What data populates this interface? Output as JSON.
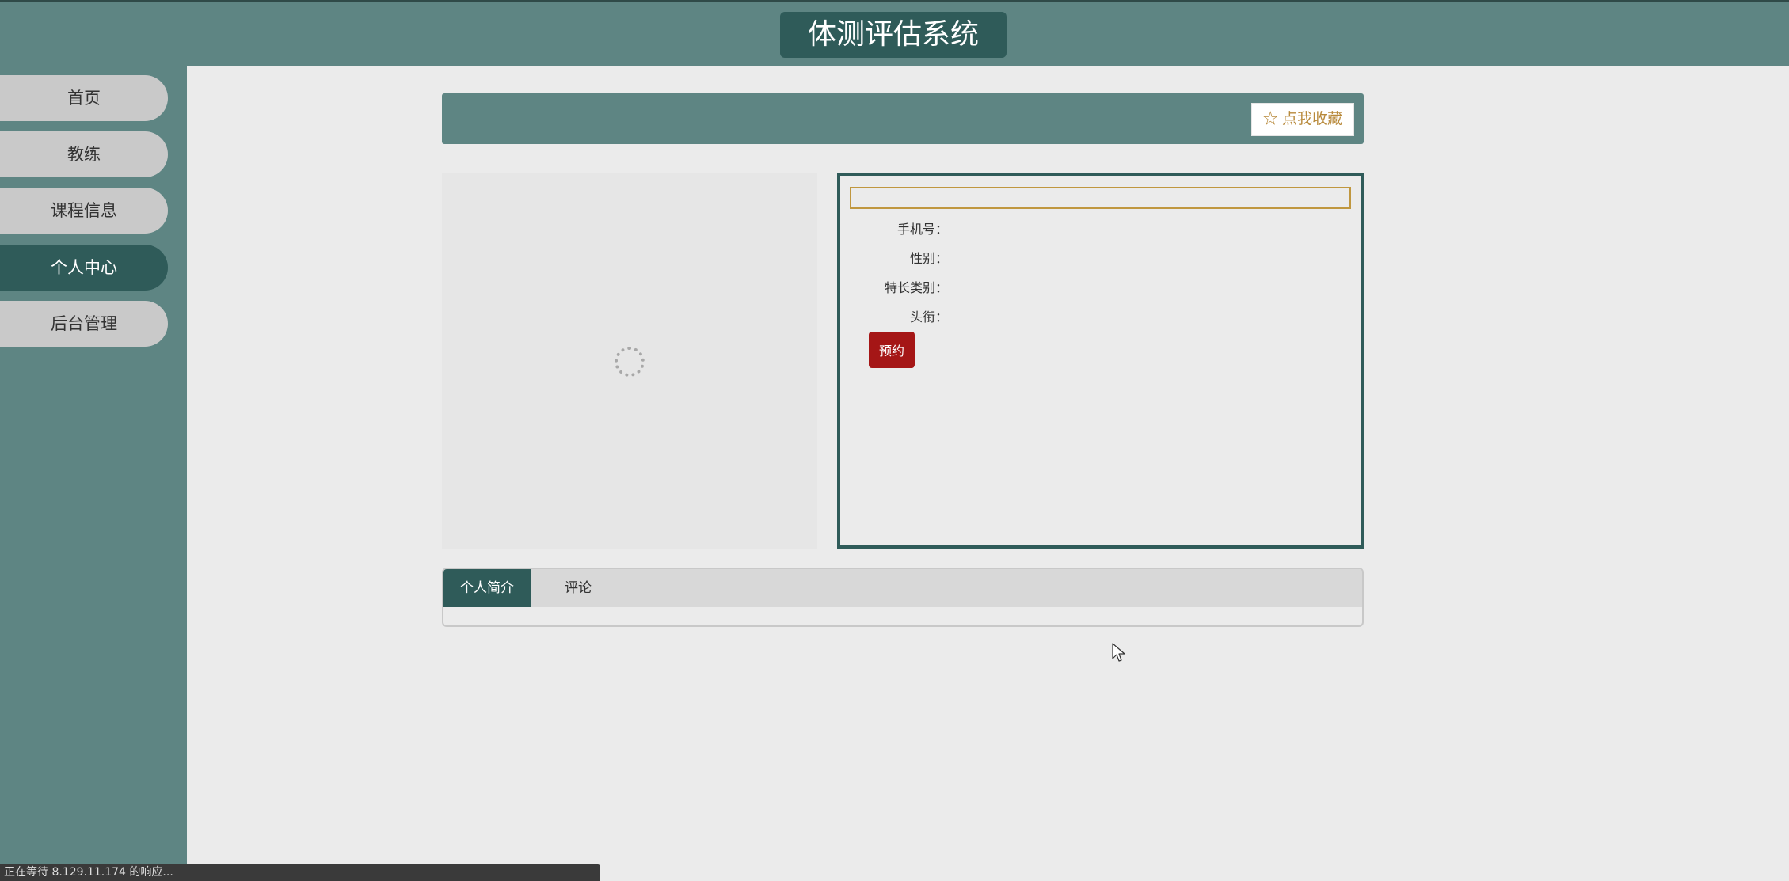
{
  "header": {
    "title": "体测评估系统"
  },
  "sidebar": {
    "items": [
      {
        "label": "首页",
        "active": false
      },
      {
        "label": "教练",
        "active": false
      },
      {
        "label": "课程信息",
        "active": false
      },
      {
        "label": "个人中心",
        "active": true
      },
      {
        "label": "后台管理",
        "active": false
      }
    ]
  },
  "detail": {
    "favorite_label": "☆ 点我收藏"
  },
  "info": {
    "name_value": "",
    "fields": [
      {
        "label": "手机号：",
        "value": ""
      },
      {
        "label": "性别：",
        "value": ""
      },
      {
        "label": "特长类别：",
        "value": ""
      },
      {
        "label": "头衔：",
        "value": ""
      }
    ],
    "book_label": "预约"
  },
  "tabs": [
    {
      "label": "个人简介",
      "active": true
    },
    {
      "label": "评论",
      "active": false
    }
  ],
  "status_bar": {
    "text": "正在等待 8.129.11.174 的响应..."
  },
  "colors": {
    "teal": "#5e8583",
    "dark_teal": "#2f5b59",
    "gold": "#c0973f",
    "red": "#a51616"
  }
}
